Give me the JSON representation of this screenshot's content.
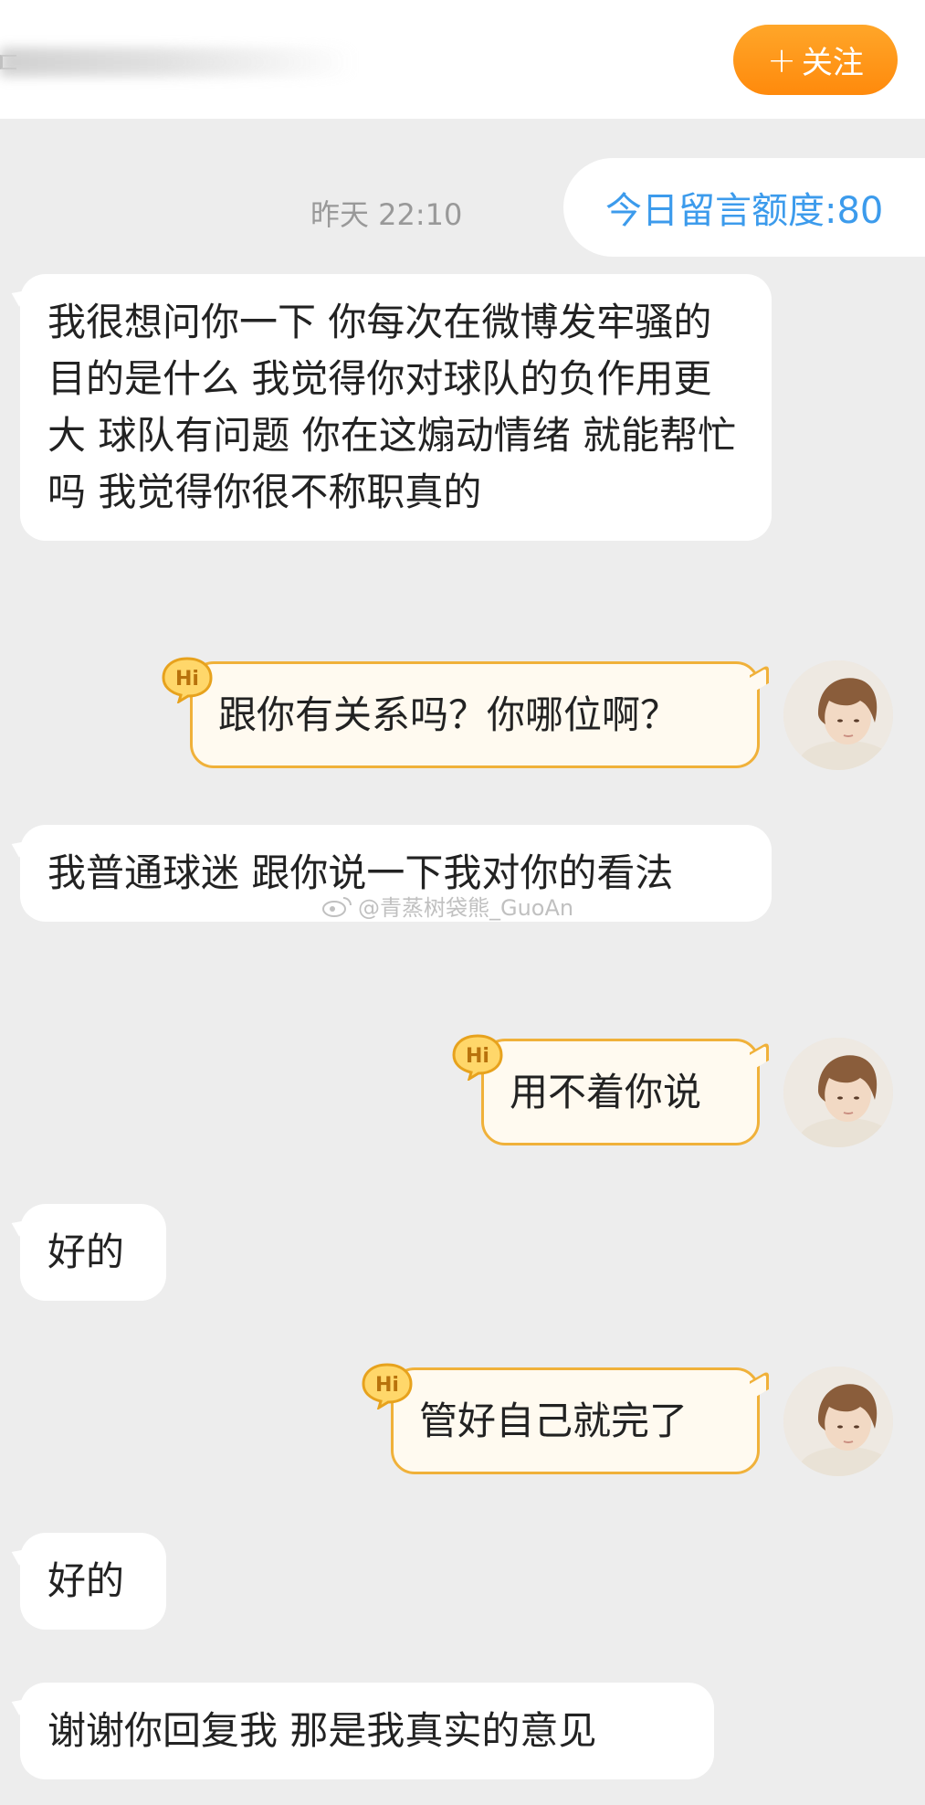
{
  "header": {
    "follow_label": "关注",
    "follow_plus": "+"
  },
  "chat": {
    "timestamp": "昨天 22:10",
    "quota": "今日留言额度:80",
    "messages": [
      {
        "side": "left",
        "text": "我很想问你一下 你每次在微博发牢骚的目的是什么 我觉得你对球队的负作用更大 球队有问题 你在这煽动情绪 就能帮忙吗 我觉得你很不称职真的"
      },
      {
        "side": "right",
        "text": "跟你有关系吗？你哪位啊？"
      },
      {
        "side": "left",
        "text": "我普通球迷 跟你说一下我对你的看法"
      },
      {
        "side": "right",
        "text": "用不着你说"
      },
      {
        "side": "left",
        "text": "好的"
      },
      {
        "side": "right",
        "text": "管好自己就完了"
      },
      {
        "side": "left",
        "text": "好的"
      },
      {
        "side": "left",
        "text": "谢谢你回复我 那是我真实的意见"
      }
    ],
    "badge_text": "Hi"
  },
  "watermark": "@青蒸树袋熊_GuoAn",
  "colors": {
    "accent_orange": "#ff9a1a",
    "quota_blue": "#3c9bec",
    "bubble_border": "#f0b13a",
    "background": "#ededed"
  },
  "icons": {
    "hi_badge": "hi-speech-badge-icon",
    "weibo": "weibo-logo-icon"
  }
}
